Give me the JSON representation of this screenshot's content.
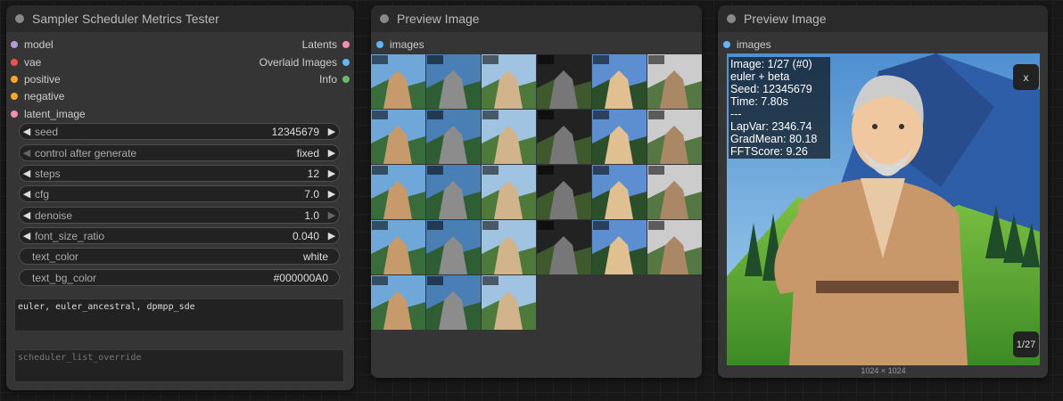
{
  "node1": {
    "title": "Sampler Scheduler Metrics Tester",
    "inputs": [
      {
        "label": "model",
        "color": "#b39ddb"
      },
      {
        "label": "vae",
        "color": "#ef5350"
      },
      {
        "label": "positive",
        "color": "#ffa726"
      },
      {
        "label": "negative",
        "color": "#ffa726"
      },
      {
        "label": "latent_image",
        "color": "#f48fb1"
      }
    ],
    "outputs": [
      {
        "label": "Latents",
        "color": "#f48fb1"
      },
      {
        "label": "Overlaid Images",
        "color": "#64b5f6"
      },
      {
        "label": "Info",
        "color": "#66bb6a"
      }
    ],
    "widgets": [
      {
        "label": "seed",
        "value": "12345679"
      },
      {
        "label": "control after generate",
        "value": "fixed"
      },
      {
        "label": "steps",
        "value": "12"
      },
      {
        "label": "cfg",
        "value": "7.0"
      },
      {
        "label": "denoise",
        "value": "1.0"
      },
      {
        "label": "font_size_ratio",
        "value": "0.040"
      },
      {
        "label": "text_color",
        "value": "white"
      },
      {
        "label": "text_bg_color",
        "value": "#000000A0"
      }
    ],
    "sampler_list": "euler, euler_ancestral, dpmpp_sde",
    "scheduler_placeholder": "scheduler_list_override"
  },
  "node2": {
    "title": "Preview Image",
    "input_label": "images",
    "input_color": "#64b5f6",
    "thumb_count": 27
  },
  "node3": {
    "title": "Preview Image",
    "input_label": "images",
    "input_color": "#64b5f6",
    "overlay": {
      "line1": "Image: 1/27 (#0)",
      "line2": "euler + beta",
      "line3": "Seed: 12345679",
      "line4": "Time: 7.80s",
      "line5": "---",
      "line6": "LapVar: 2346.74",
      "line7": "GradMean: 80.18",
      "line8": "FFTScore: 9.26"
    },
    "close_label": "x",
    "counter": "1/27",
    "dimensions": "1024 × 1024"
  }
}
